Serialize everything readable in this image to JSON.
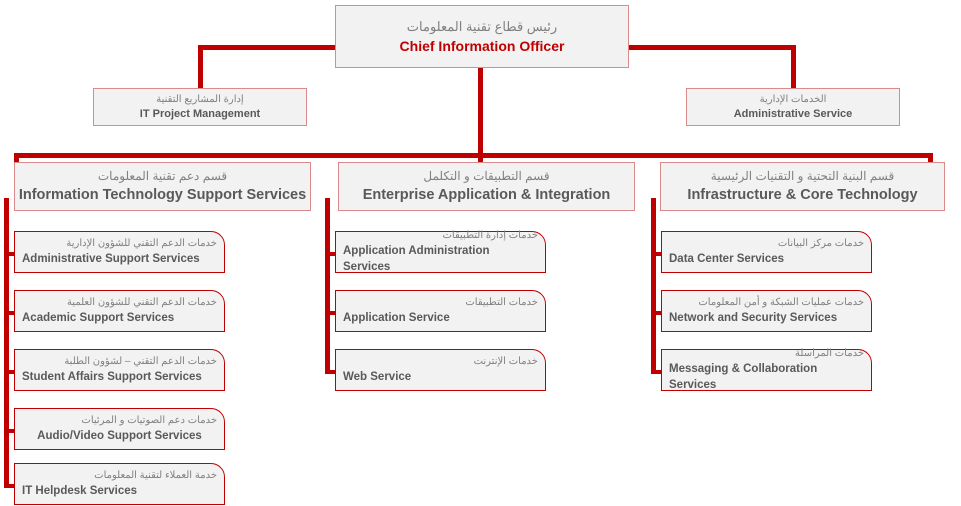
{
  "colors": {
    "line": "#C00000",
    "box_fill": "#F2F2F2",
    "box_border": "#C00000",
    "arabic_text": "#808080",
    "english_text": "#595959",
    "root_english_text": "#C00000",
    "page_background": "#FFFFFF"
  },
  "root": {
    "arabic": "رئيس قطاع تقنية المعلومات",
    "english": "Chief Information Officer"
  },
  "staff": [
    {
      "arabic": "إدارة المشاريع التقنية",
      "english": "IT Project Management",
      "side": "left"
    },
    {
      "arabic": "الخدمات الإدارية",
      "english": "Administrative Service",
      "side": "right"
    }
  ],
  "departments": [
    {
      "arabic": "قسم دعم تقنية المعلومات",
      "english": "Information Technology Support Services",
      "services": [
        {
          "arabic": "خدمات الدعم التقني للشؤون الإدارية",
          "english": "Administrative Support Services"
        },
        {
          "arabic": "خدمات الدعم التقني للشؤون العلمية",
          "english": "Academic Support Services"
        },
        {
          "arabic": "خدمات الدعم التقني – لشؤون الطلبة",
          "english": "Student Affairs Support Services"
        },
        {
          "arabic": "خدمات دعم الصوتيات و المرئيات",
          "english": "Audio/Video  Support Services"
        },
        {
          "arabic": "خدمة العملاء لتقنية المعلومات",
          "english": "IT Helpdesk Services"
        }
      ]
    },
    {
      "arabic": "قسم التطبيقات و التكلمل",
      "english": "Enterprise Application & Integration",
      "services": [
        {
          "arabic": "خدمات إدارة التطبيقات",
          "english": "Application Administration Services"
        },
        {
          "arabic": "خدمات التطبيقات",
          "english": "Application Service"
        },
        {
          "arabic": "خدمات الإنترنت",
          "english": "Web Service"
        }
      ]
    },
    {
      "arabic": "قسم البنية التحتية و التقنيات الرئيسية",
      "english": "Infrastructure & Core Technology",
      "services": [
        {
          "arabic": "خدمات مركز البيانات",
          "english": "Data Center Services"
        },
        {
          "arabic": "خدمات عمليات الشبكة و أمن المعلومات",
          "english": "Network and Security Services"
        },
        {
          "arabic": "خدمات المراسلة",
          "english": "Messaging & Collaboration Services"
        }
      ]
    }
  ]
}
